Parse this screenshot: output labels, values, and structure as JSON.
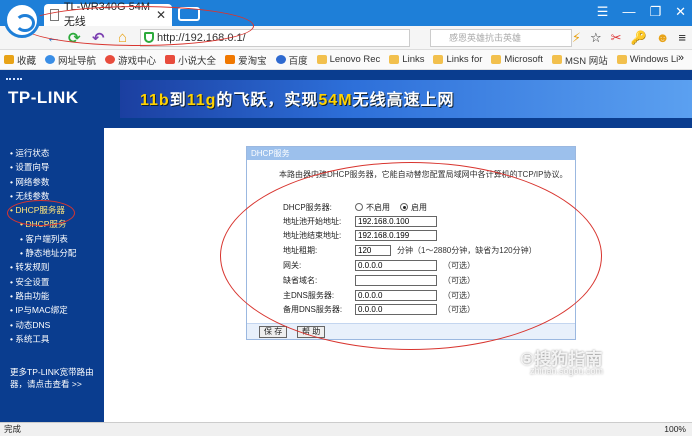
{
  "browser": {
    "tab_title": "TL-WR340G 54M无线",
    "tab_close": "✕",
    "url": "http://192.168.0.1/",
    "search_placeholder": "感恩英雄抗击英雄",
    "window_controls": [
      "☰",
      "—",
      "❐",
      "✕"
    ],
    "toolbar_icons": [
      "⚡",
      "☆",
      "▾",
      "☺",
      "✂",
      "🔑",
      "☻",
      "≡"
    ]
  },
  "bookmarks": {
    "items": [
      {
        "label": "收藏",
        "icon": "star-icon",
        "color": "#e8a317"
      },
      {
        "label": "网址导航",
        "icon": "globe-icon",
        "color": "#3a8ee6"
      },
      {
        "label": "游戏中心",
        "icon": "game-icon",
        "color": "#e84c3d"
      },
      {
        "label": "小说大全",
        "icon": "book-icon",
        "color": "#e84c3d"
      },
      {
        "label": "爱淘宝",
        "icon": "shop-icon",
        "color": "#f07800"
      },
      {
        "label": "百度",
        "icon": "paw-icon",
        "color": "#2f6ad0"
      },
      {
        "label": "Lenovo Rec",
        "icon": "folder-icon"
      },
      {
        "label": "Links",
        "icon": "folder-icon"
      },
      {
        "label": "Links for",
        "icon": "folder-icon"
      },
      {
        "label": "Microsoft",
        "icon": "folder-icon"
      },
      {
        "label": "MSN 网站",
        "icon": "folder-icon"
      },
      {
        "label": "Windows Li",
        "icon": "folder-icon"
      }
    ],
    "more": "»"
  },
  "router": {
    "brand": "TP-LINK",
    "banner_part1": "11b",
    "banner_mid1": "到",
    "banner_part2": "11g",
    "banner_mid2": "的飞跃，实现",
    "banner_part3": "54M",
    "banner_tail": "无线高速上网",
    "menu": [
      {
        "label": "• 运行状态",
        "level": 0
      },
      {
        "label": "• 设置向导",
        "level": 0
      },
      {
        "label": "• 网络参数",
        "level": 0
      },
      {
        "label": "• 无线参数",
        "level": 0
      },
      {
        "label": "• DHCP服务器",
        "level": 0,
        "active": true
      },
      {
        "label": "• DHCP服务",
        "level": 1,
        "active": true
      },
      {
        "label": "• 客户端列表",
        "level": 1
      },
      {
        "label": "• 静态地址分配",
        "level": 1
      },
      {
        "label": "• 转发规则",
        "level": 0
      },
      {
        "label": "• 安全设置",
        "level": 0
      },
      {
        "label": "• 路由功能",
        "level": 0
      },
      {
        "label": "• IP与MAC绑定",
        "level": 0
      },
      {
        "label": "• 动态DNS",
        "level": 0
      },
      {
        "label": "• 系统工具",
        "level": 0
      }
    ],
    "more_note_line1": "更多TP-LINK宽带路由",
    "more_note_line2": "器，请点击查看 >>",
    "dhcp": {
      "panel_title": "DHCP服务",
      "description": "本路由器内建DHCP服务器，它能自动替您配置局域网中各计算机的TCP/IP协议。",
      "server_label": "DHCP服务器:",
      "radio_off": "不启用",
      "radio_on": "启用",
      "radio_selected": "启用",
      "start_label": "地址池开始地址:",
      "start_value": "192.168.0.100",
      "end_label": "地址池结束地址:",
      "end_value": "192.168.0.199",
      "lease_label": "地址租期:",
      "lease_value": "120",
      "lease_hint": "分钟（1～2880分钟，缺省为120分钟）",
      "gateway_label": "网关:",
      "gateway_value": "0.0.0.0",
      "domain_label": "缺省域名:",
      "domain_value": "",
      "dns1_label": "主DNS服务器:",
      "dns1_value": "0.0.0.0",
      "dns2_label": "备用DNS服务器:",
      "dns2_value": "0.0.0.0",
      "optional": "（可选）",
      "save_button": "保 存",
      "help_button": "帮 助"
    }
  },
  "watermark": {
    "line1": "⑤搜狗指南",
    "line2": "zhinan.sogou.com"
  },
  "status": {
    "left": "完成",
    "zoom": "100%"
  }
}
